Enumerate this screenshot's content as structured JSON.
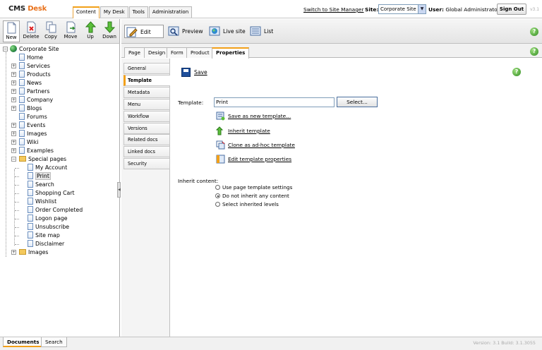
{
  "header": {
    "logo_part1": "CMS",
    "logo_part2": "Desk",
    "tabs": [
      {
        "label": "Content",
        "active": true
      },
      {
        "label": "My Desk"
      },
      {
        "label": "Tools"
      },
      {
        "label": "Administration"
      }
    ],
    "switch_link": "Switch to Site Manager",
    "site_label": "Site:",
    "site_value": "Corporate Site",
    "user_label": "User:",
    "user_name": "Global Administrator",
    "signout_label": "Sign Out",
    "version_badge": "v3.1"
  },
  "left_toolbar": {
    "new": "New",
    "delete": "Delete",
    "copy": "Copy",
    "move": "Move",
    "up": "Up",
    "down": "Down"
  },
  "tree": {
    "root": "Corporate Site",
    "items": [
      "Home",
      "Services",
      "Products",
      "News",
      "Partners",
      "Company",
      "Blogs",
      "Forums",
      "Events",
      "Images",
      "Wiki",
      "Examples",
      "Special pages"
    ],
    "special_children": [
      "My Account",
      "Print",
      "Search",
      "Shopping Cart",
      "Wishlist",
      "Order Completed",
      "Logon page",
      "Unsubscribe",
      "Site map",
      "Disclaimer"
    ],
    "last": "Images"
  },
  "right_toolbar": {
    "edit": "Edit",
    "preview": "Preview",
    "live_site": "Live site",
    "list": "List"
  },
  "sub_tabs": [
    "Page",
    "Design",
    "Form",
    "Product",
    "Properties"
  ],
  "vertical_tabs": [
    "General",
    "Template",
    "Metadata",
    "Menu",
    "Workflow",
    "Versions",
    "Related docs",
    "Linked docs",
    "Security"
  ],
  "content": {
    "save_label": "Save",
    "template_label": "Template:",
    "template_value": "Print",
    "select_button": "Select...",
    "actions": [
      "Save as new template...",
      "Inherit template",
      "Clone as ad-hoc template",
      "Edit template properties"
    ],
    "inherit_label": "Inherit content:",
    "radio_options": [
      {
        "label": "Use page template settings",
        "checked": false
      },
      {
        "label": "Do not inherit any content",
        "checked": true
      },
      {
        "label": "Select inherited levels",
        "checked": false
      }
    ]
  },
  "bottom_tabs": [
    "Documents",
    "Search"
  ],
  "build_info": "Version: 3.1 Build: 3.1.3055",
  "colors": {
    "accent": "#f2a019",
    "logo_orange": "#e8711a",
    "help_green": "#2f8a1f"
  }
}
